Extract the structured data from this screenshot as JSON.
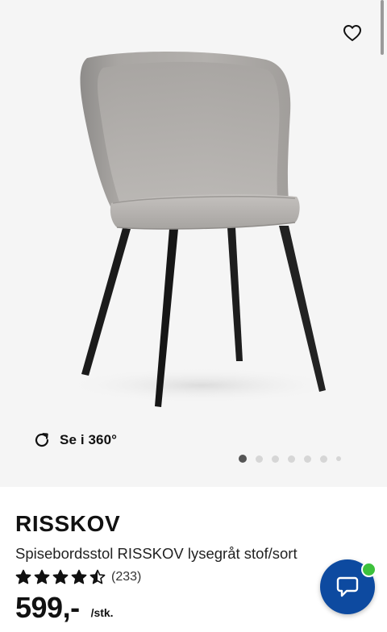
{
  "gallery": {
    "view360_label": "Se i 360°",
    "image_count": 7,
    "active_image": 1,
    "background_color": "#f5f5f5"
  },
  "product": {
    "name": "RISSKOV",
    "description": "Spisebordsstol RISSKOV lysegråt stof/sort",
    "rating": {
      "stars": 4.5,
      "max": 5,
      "count": "(233)"
    },
    "price": {
      "value": "599,-",
      "unit": "/stk."
    }
  },
  "icons": {
    "favorite": "heart-outline-icon",
    "view360": "rotate-icon",
    "chat": "chat-bubble-icon",
    "rating": "star-icon"
  },
  "colors": {
    "chat_button": "#0d4aa0",
    "online_indicator": "#3dc13c",
    "text": "#111111",
    "dot_active": "#555555",
    "dot_inactive": "#d6d6d6"
  }
}
